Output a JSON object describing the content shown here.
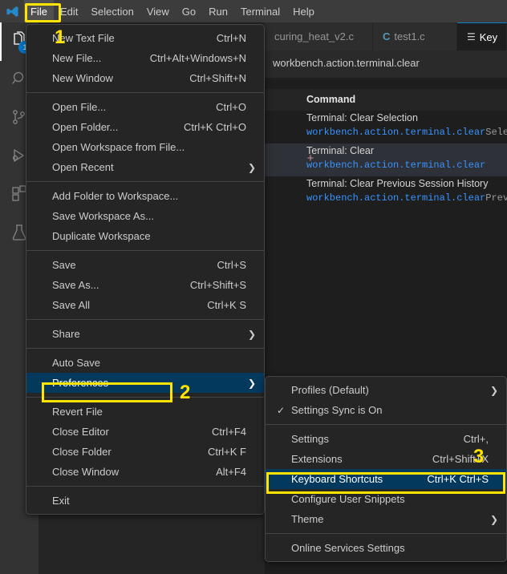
{
  "window": {
    "logo_icon": "vscode-logo-icon"
  },
  "menubar": {
    "items": [
      {
        "label": "File",
        "active": true
      },
      {
        "label": "Edit",
        "active": false
      },
      {
        "label": "Selection",
        "active": false
      },
      {
        "label": "View",
        "active": false
      },
      {
        "label": "Go",
        "active": false
      },
      {
        "label": "Run",
        "active": false
      },
      {
        "label": "Terminal",
        "active": false
      },
      {
        "label": "Help",
        "active": false
      }
    ]
  },
  "activity_bar": {
    "items": [
      {
        "name": "explorer",
        "icon": "files-icon",
        "selected": true,
        "badge": "1"
      },
      {
        "name": "search",
        "icon": "search-icon",
        "selected": false,
        "badge": ""
      },
      {
        "name": "source-control",
        "icon": "source-control-icon",
        "selected": false,
        "badge": ""
      },
      {
        "name": "run-and-debug",
        "icon": "run-debug-icon",
        "selected": false,
        "badge": ""
      },
      {
        "name": "extensions",
        "icon": "extensions-icon",
        "selected": false,
        "badge": ""
      },
      {
        "name": "testing",
        "icon": "beaker-icon",
        "selected": false,
        "badge": ""
      }
    ]
  },
  "editor": {
    "tabs": [
      {
        "label": "curing_heat_v2.c",
        "icon": "",
        "active": false
      },
      {
        "label": "test1.c",
        "icon": "C",
        "active": false
      },
      {
        "label": "Key",
        "icon": "list-icon",
        "active": true
      }
    ],
    "keybindings": {
      "search_value": "workbench.action.terminal.clear",
      "column_header": "Command",
      "rows": [
        {
          "title": "Terminal: Clear Selection",
          "id_match": "workbench.action.terminal.clear",
          "id_rest": "Selectio",
          "selected": false,
          "add_icon": ""
        },
        {
          "title": "Terminal: Clear",
          "id_match": "workbench.action.terminal.clear",
          "id_rest": "",
          "selected": true,
          "add_icon": "+"
        },
        {
          "title": "Terminal: Clear Previous Session History",
          "id_match": "workbench.action.terminal.clear",
          "id_rest": "Previous",
          "selected": false,
          "add_icon": ""
        }
      ]
    }
  },
  "file_menu": {
    "groups": [
      [
        {
          "label": "New Text File",
          "keys": "Ctrl+N",
          "submenu": false,
          "checked": false,
          "selected": false
        },
        {
          "label": "New File...",
          "keys": "Ctrl+Alt+Windows+N",
          "submenu": false,
          "checked": false,
          "selected": false
        },
        {
          "label": "New Window",
          "keys": "Ctrl+Shift+N",
          "submenu": false,
          "checked": false,
          "selected": false
        }
      ],
      [
        {
          "label": "Open File...",
          "keys": "Ctrl+O",
          "submenu": false,
          "checked": false,
          "selected": false
        },
        {
          "label": "Open Folder...",
          "keys": "Ctrl+K Ctrl+O",
          "submenu": false,
          "checked": false,
          "selected": false
        },
        {
          "label": "Open Workspace from File...",
          "keys": "",
          "submenu": false,
          "checked": false,
          "selected": false
        },
        {
          "label": "Open Recent",
          "keys": "",
          "submenu": true,
          "checked": false,
          "selected": false
        }
      ],
      [
        {
          "label": "Add Folder to Workspace...",
          "keys": "",
          "submenu": false,
          "checked": false,
          "selected": false
        },
        {
          "label": "Save Workspace As...",
          "keys": "",
          "submenu": false,
          "checked": false,
          "selected": false
        },
        {
          "label": "Duplicate Workspace",
          "keys": "",
          "submenu": false,
          "checked": false,
          "selected": false
        }
      ],
      [
        {
          "label": "Save",
          "keys": "Ctrl+S",
          "submenu": false,
          "checked": false,
          "selected": false
        },
        {
          "label": "Save As...",
          "keys": "Ctrl+Shift+S",
          "submenu": false,
          "checked": false,
          "selected": false
        },
        {
          "label": "Save All",
          "keys": "Ctrl+K S",
          "submenu": false,
          "checked": false,
          "selected": false
        }
      ],
      [
        {
          "label": "Share",
          "keys": "",
          "submenu": true,
          "checked": false,
          "selected": false
        }
      ],
      [
        {
          "label": "Auto Save",
          "keys": "",
          "submenu": false,
          "checked": false,
          "selected": false
        },
        {
          "label": "Preferences",
          "keys": "",
          "submenu": true,
          "checked": false,
          "selected": true
        }
      ],
      [
        {
          "label": "Revert File",
          "keys": "",
          "submenu": false,
          "checked": false,
          "selected": false
        },
        {
          "label": "Close Editor",
          "keys": "Ctrl+F4",
          "submenu": false,
          "checked": false,
          "selected": false
        },
        {
          "label": "Close Folder",
          "keys": "Ctrl+K F",
          "submenu": false,
          "checked": false,
          "selected": false
        },
        {
          "label": "Close Window",
          "keys": "Alt+F4",
          "submenu": false,
          "checked": false,
          "selected": false
        }
      ],
      [
        {
          "label": "Exit",
          "keys": "",
          "submenu": false,
          "checked": false,
          "selected": false
        }
      ]
    ]
  },
  "preferences_menu": {
    "groups": [
      [
        {
          "label": "Profiles (Default)",
          "keys": "",
          "submenu": true,
          "checked": false,
          "selected": false
        },
        {
          "label": "Settings Sync is On",
          "keys": "",
          "submenu": false,
          "checked": true,
          "selected": false
        }
      ],
      [
        {
          "label": "Settings",
          "keys": "Ctrl+,",
          "submenu": false,
          "checked": false,
          "selected": false
        },
        {
          "label": "Extensions",
          "keys": "Ctrl+Shift+X",
          "submenu": false,
          "checked": false,
          "selected": false
        },
        {
          "label": "Keyboard Shortcuts",
          "keys": "Ctrl+K Ctrl+S",
          "submenu": false,
          "checked": false,
          "selected": true
        },
        {
          "label": "Configure User Snippets",
          "keys": "",
          "submenu": false,
          "checked": false,
          "selected": false
        },
        {
          "label": "Theme",
          "keys": "",
          "submenu": true,
          "checked": false,
          "selected": false
        }
      ],
      [
        {
          "label": "Online Services Settings",
          "keys": "",
          "submenu": false,
          "checked": false,
          "selected": false
        }
      ]
    ]
  },
  "annotations": {
    "highlight_color": "#ffe400",
    "selection_color": "#04395e",
    "steps": [
      {
        "number": "1",
        "target": "File menubar item"
      },
      {
        "number": "2",
        "target": "Preferences menu item"
      },
      {
        "number": "3",
        "target": "Keyboard Shortcuts menu item"
      }
    ]
  }
}
